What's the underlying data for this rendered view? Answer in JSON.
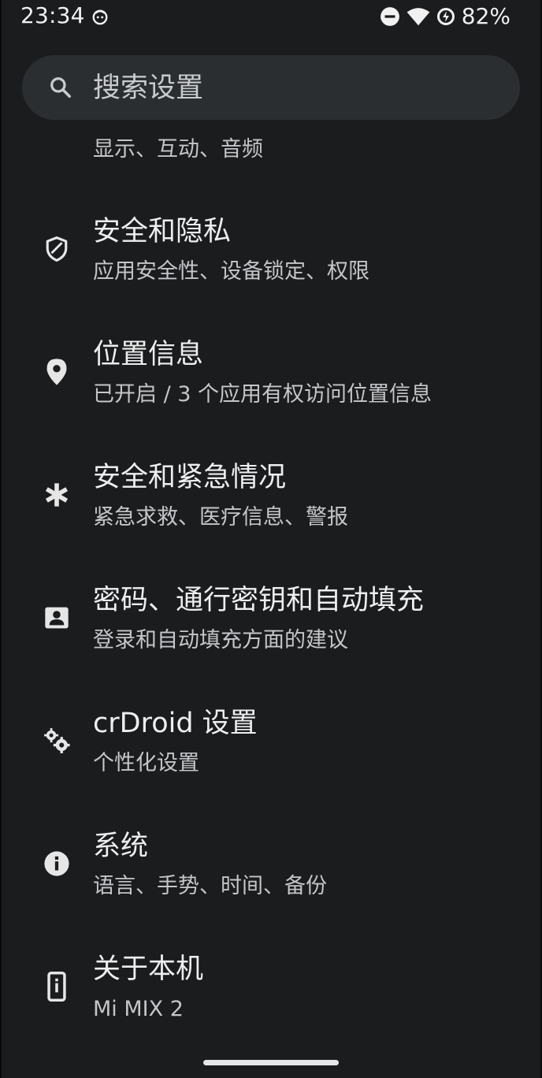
{
  "status_bar": {
    "time": "23:34",
    "battery_percent": "82%"
  },
  "search": {
    "placeholder": "搜索设置"
  },
  "partial_item": {
    "subtitle": "显示、互动、音频"
  },
  "settings": [
    {
      "icon": "shield-icon",
      "title": "安全和隐私",
      "subtitle": "应用安全性、设备锁定、权限"
    },
    {
      "icon": "location-pin-icon",
      "title": "位置信息",
      "subtitle": "已开启 / 3 个应用有权访问位置信息"
    },
    {
      "icon": "asterisk-icon",
      "title": "安全和紧急情况",
      "subtitle": "紧急求救、医疗信息、警报"
    },
    {
      "icon": "account-box-icon",
      "title": "密码、通行密钥和自动填充",
      "subtitle": "登录和自动填充方面的建议"
    },
    {
      "icon": "gears-icon",
      "title": "crDroid 设置",
      "subtitle": "个性化设置"
    },
    {
      "icon": "info-icon",
      "title": "系统",
      "subtitle": "语言、手势、时间、备份"
    },
    {
      "icon": "phone-info-icon",
      "title": "关于本机",
      "subtitle": "Mi MIX 2"
    }
  ],
  "colors": {
    "background": "#1a1c1e",
    "search_background": "#2b2e31",
    "title_text": "#eeeeee",
    "subtitle_text": "#c4c6c9"
  }
}
